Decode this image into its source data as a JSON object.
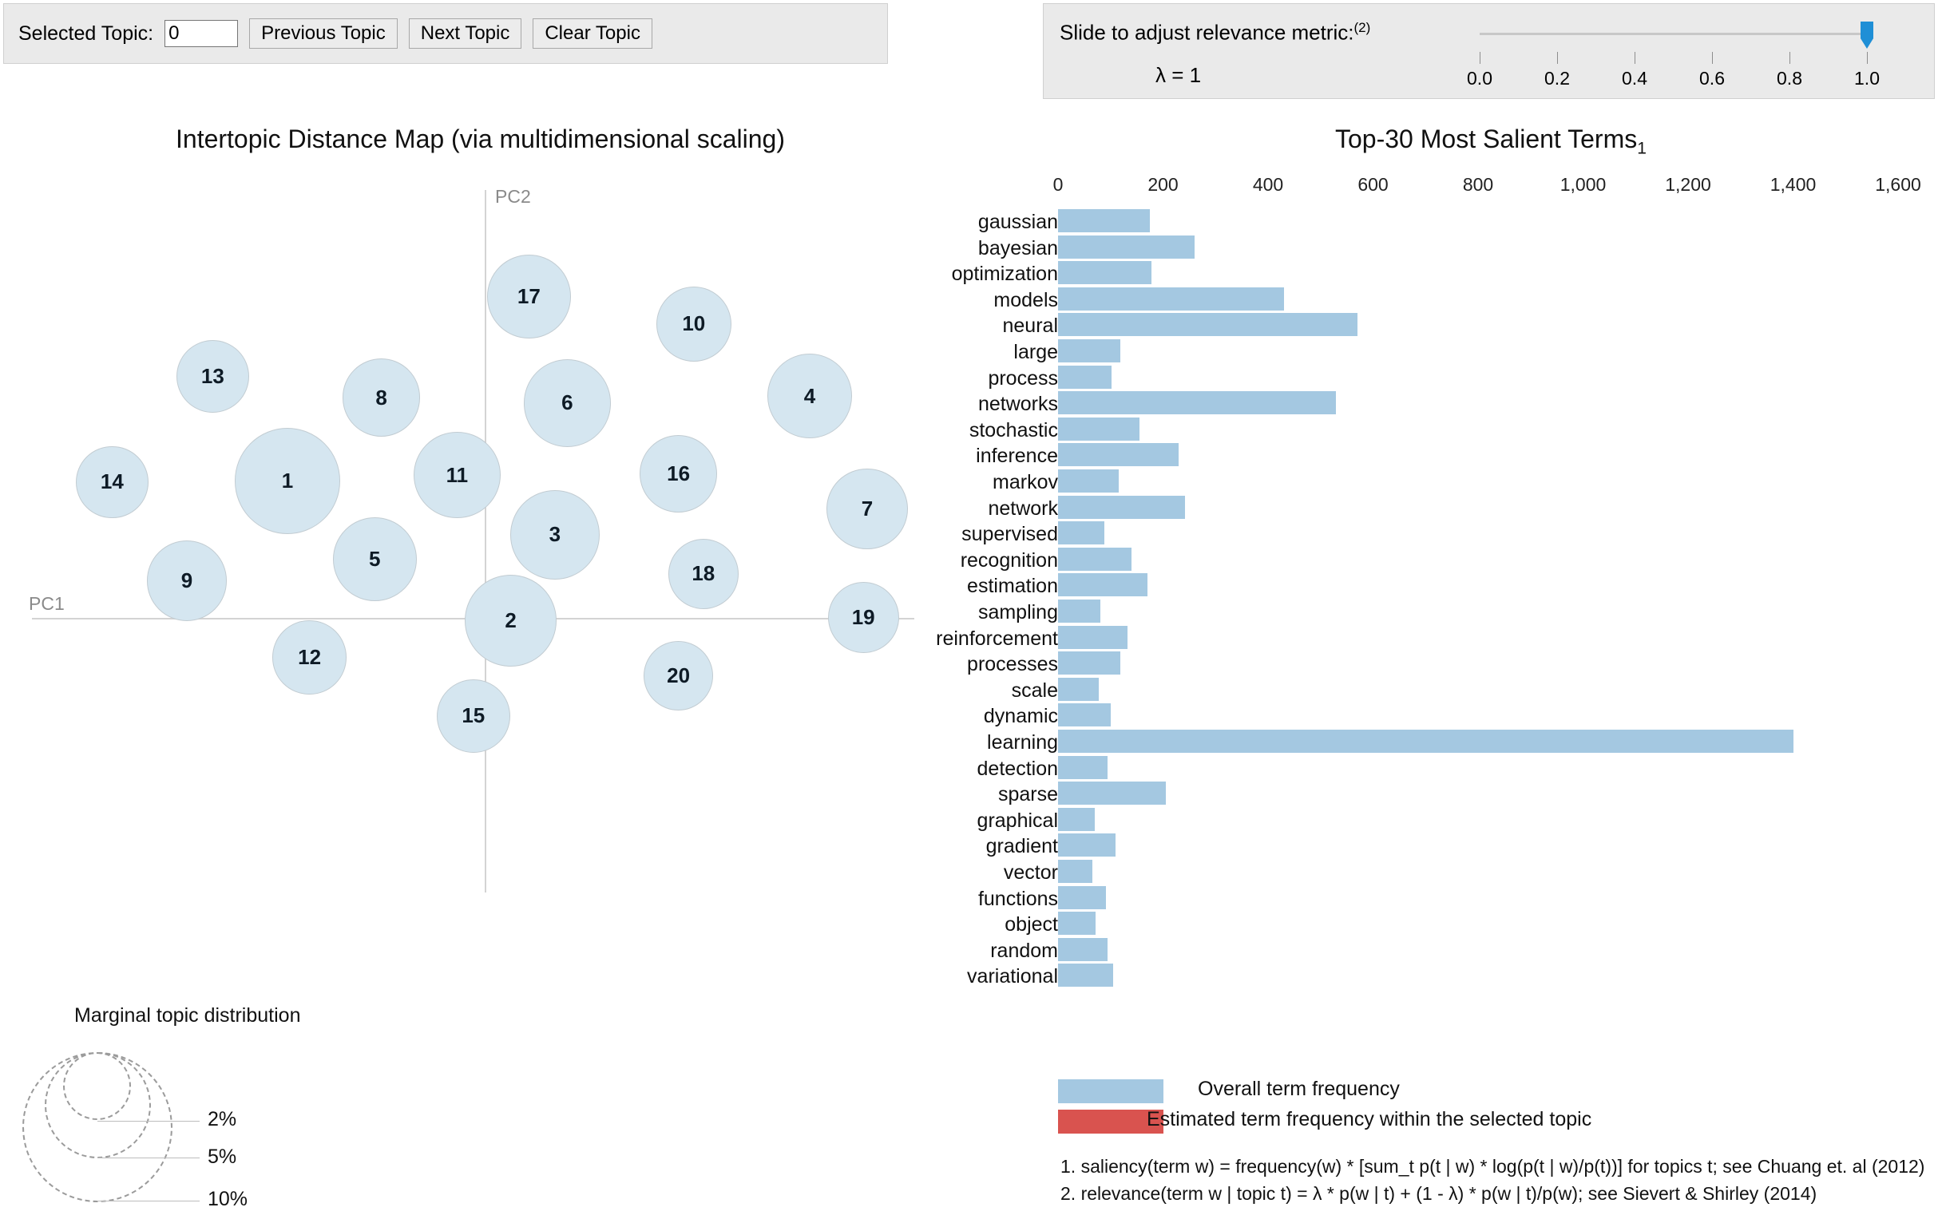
{
  "topic_toolbar": {
    "selected_topic_label": "Selected Topic:",
    "selected_topic_value": "0",
    "previous_button": "Previous Topic",
    "next_button": "Next Topic",
    "clear_button": "Clear Topic"
  },
  "lambda_toolbar": {
    "caption": "Slide to adjust relevance metric:",
    "caption_superscript": "(2)",
    "lambda_display": "λ = 1",
    "slider_value": 1.0,
    "tick_labels": [
      "0.0",
      "0.2",
      "0.4",
      "0.6",
      "0.8",
      "1.0"
    ],
    "handle_color": "#1f8fd6"
  },
  "map_panel": {
    "title": "Intertopic Distance Map (via multidimensional scaling)",
    "x_axis_name": "PC1",
    "y_axis_name": "PC2",
    "bubble_fill": "#d5e6f0",
    "bubble_stroke": "#c2ccd2"
  },
  "marginal_topic_distribution": {
    "title": "Marginal topic distribution",
    "percent_labels": [
      "2%",
      "5%",
      "10%"
    ]
  },
  "terms_panel": {
    "title": "Top-30 Most Salient Terms",
    "title_superscript": "1",
    "legend": {
      "overall_label": "Overall term frequency",
      "overall_color": "#a4c8e1",
      "estimated_label": "Estimated term frequency within the selected topic",
      "estimated_color": "#d9534f"
    },
    "footnotes": [
      "1. saliency(term w) = frequency(w) * [sum_t p(t | w) * log(p(t | w)/p(t))] for topics t; see Chuang et. al (2012)",
      "2. relevance(term w | topic t) = λ * p(w | t) + (1 - λ) * p(w | t)/p(w); see Sievert & Shirley (2014)"
    ]
  },
  "chart_data": [
    {
      "type": "scatter",
      "title": "Intertopic Distance Map (via multidimensional scaling)",
      "xlabel": "PC1",
      "ylabel": "PC2",
      "grid": false,
      "legend": "none",
      "note": "Bubble area encodes marginal topic distribution (2%, 5%, 10% reference circles)",
      "points": [
        {
          "label": "17",
          "x": 0.552,
          "y": 0.861,
          "r": 0.0435
        },
        {
          "label": "10",
          "x": 0.724,
          "y": 0.825,
          "r": 0.0392
        },
        {
          "label": "13",
          "x": 0.222,
          "y": 0.757,
          "r": 0.038
        },
        {
          "label": "8",
          "x": 0.398,
          "y": 0.729,
          "r": 0.0407
        },
        {
          "label": "6",
          "x": 0.592,
          "y": 0.722,
          "r": 0.0457
        },
        {
          "label": "4",
          "x": 0.845,
          "y": 0.731,
          "r": 0.044
        },
        {
          "label": "14",
          "x": 0.117,
          "y": 0.619,
          "r": 0.0377
        },
        {
          "label": "1",
          "x": 0.3,
          "y": 0.62,
          "r": 0.0554
        },
        {
          "label": "11",
          "x": 0.477,
          "y": 0.628,
          "r": 0.0453
        },
        {
          "label": "16",
          "x": 0.708,
          "y": 0.63,
          "r": 0.0405
        },
        {
          "label": "7",
          "x": 0.905,
          "y": 0.584,
          "r": 0.0422
        },
        {
          "label": "3",
          "x": 0.579,
          "y": 0.55,
          "r": 0.0465
        },
        {
          "label": "5",
          "x": 0.391,
          "y": 0.518,
          "r": 0.0437
        },
        {
          "label": "18",
          "x": 0.734,
          "y": 0.499,
          "r": 0.0369
        },
        {
          "label": "9",
          "x": 0.195,
          "y": 0.49,
          "r": 0.0418
        },
        {
          "label": "2",
          "x": 0.533,
          "y": 0.438,
          "r": 0.0478
        },
        {
          "label": "19",
          "x": 0.901,
          "y": 0.442,
          "r": 0.0372
        },
        {
          "label": "12",
          "x": 0.323,
          "y": 0.39,
          "r": 0.0385
        },
        {
          "label": "20",
          "x": 0.708,
          "y": 0.366,
          "r": 0.0364
        },
        {
          "label": "15",
          "x": 0.494,
          "y": 0.314,
          "r": 0.0383
        }
      ]
    },
    {
      "type": "bar",
      "orientation": "horizontal",
      "title": "Top-30 Most Salient Terms",
      "xlabel": "",
      "ylabel": "",
      "xlim": [
        0,
        1600
      ],
      "xticks": [
        0,
        200,
        400,
        600,
        800,
        1000,
        1200,
        1400,
        1600
      ],
      "xticklabels": [
        "0",
        "200",
        "400",
        "600",
        "800",
        "1,000",
        "1,200",
        "1,400",
        "1,600"
      ],
      "grid": false,
      "legend": "bottom",
      "series": [
        {
          "name": "Overall term frequency",
          "color": "#a4c8e1",
          "values": [
            175,
            260,
            178,
            430,
            570,
            118,
            102,
            530,
            155,
            230,
            115,
            242,
            88,
            140,
            170,
            80,
            132,
            118,
            78,
            100,
            1400,
            95,
            205,
            70,
            110,
            65,
            92,
            72,
            95,
            105
          ]
        }
      ],
      "categories": [
        "gaussian",
        "bayesian",
        "optimization",
        "models",
        "neural",
        "large",
        "process",
        "networks",
        "stochastic",
        "inference",
        "markov",
        "network",
        "supervised",
        "recognition",
        "estimation",
        "sampling",
        "reinforcement",
        "processes",
        "scale",
        "dynamic",
        "learning",
        "detection",
        "sparse",
        "graphical",
        "gradient",
        "vector",
        "functions",
        "object",
        "random",
        "variational"
      ]
    }
  ]
}
